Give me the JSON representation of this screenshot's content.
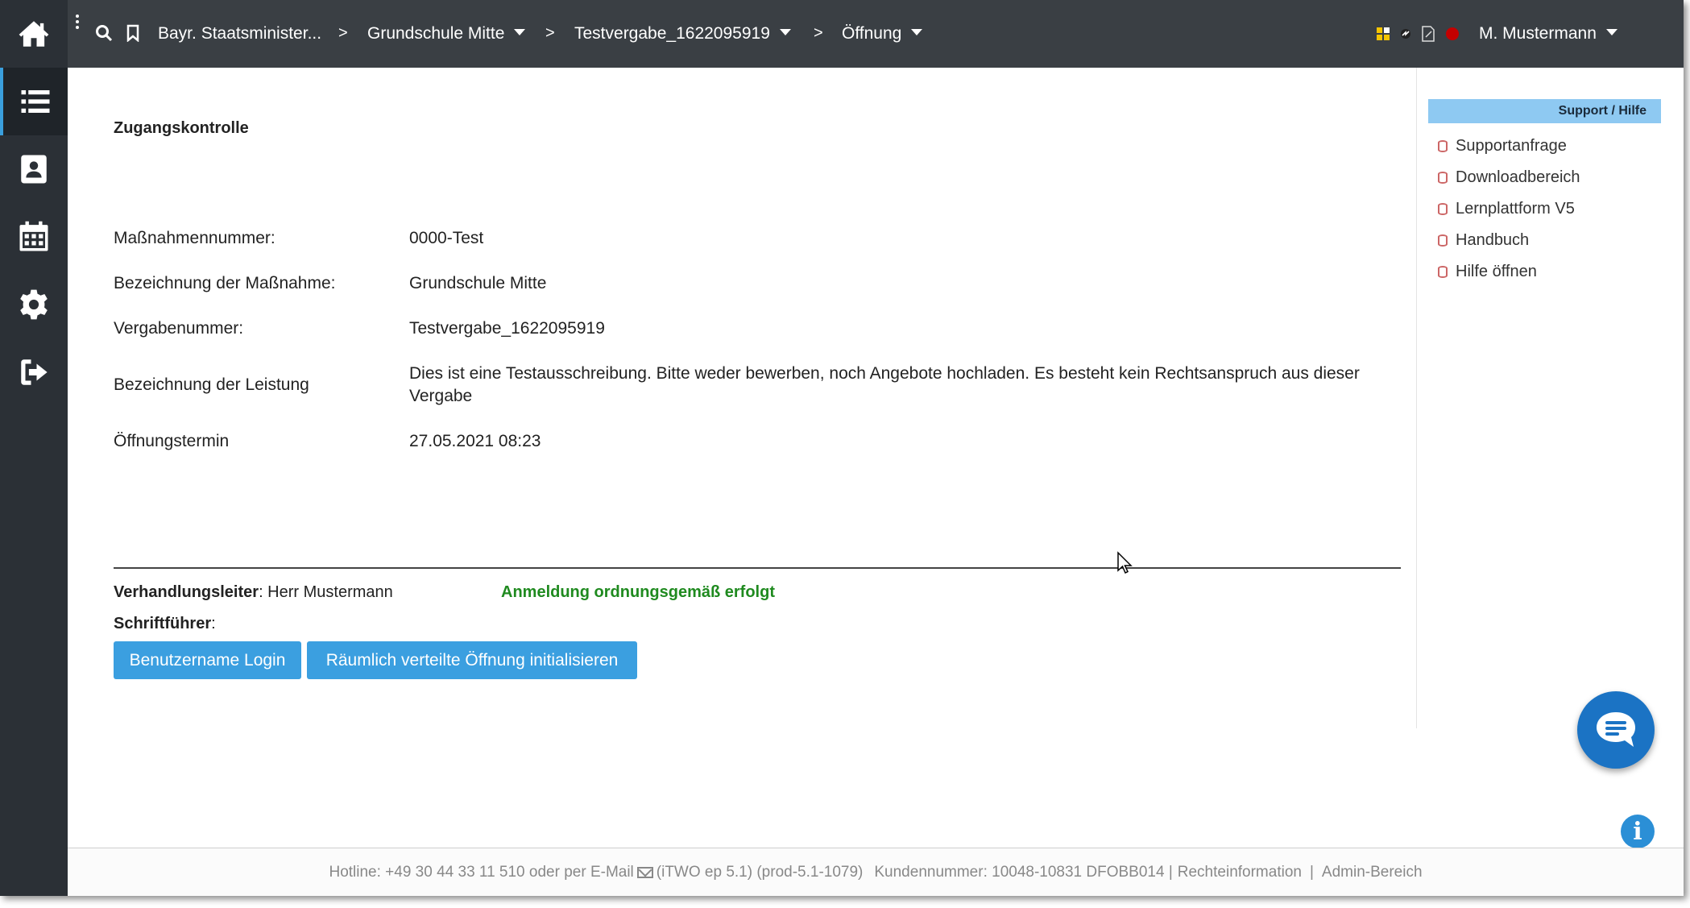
{
  "sidebar": {
    "items": [
      {
        "icon": "home-icon"
      },
      {
        "icon": "list-icon"
      },
      {
        "icon": "contact-icon"
      },
      {
        "icon": "calendar-icon"
      },
      {
        "icon": "gear-icon"
      },
      {
        "icon": "logout-icon"
      }
    ]
  },
  "topbar": {
    "crumb1": "Bayr. Staatsminister...",
    "crumb2": "Grundschule Mitte",
    "crumb3": "Testvergabe_1622095919",
    "crumb4": "Öffnung",
    "separator": ">",
    "user": "M. Mustermann"
  },
  "main": {
    "title": "Zugangskontrolle",
    "rows": [
      {
        "label": "Maßnahmennummer:",
        "value": "0000-Test"
      },
      {
        "label": "Bezeichnung der Maßnahme:",
        "value": "Grundschule Mitte"
      },
      {
        "label": "Vergabenummer:",
        "value": "Testvergabe_1622095919"
      },
      {
        "label": "Bezeichnung der Leistung",
        "value": "Dies ist eine Testausschreibung. Bitte weder bewerben, noch Angebote hochladen. Es besteht kein Rechtsanspruch aus dieser Vergabe"
      },
      {
        "label": "Öffnungstermin",
        "value": "27.05.2021 08:23"
      }
    ],
    "lead_label": "Verhandlungsleiter",
    "lead_value": ": Herr Mustermann",
    "status": "Anmeldung ordnungsgemäß erfolgt",
    "writer_label": "Schriftführer",
    "writer_colon": ":",
    "btn_login": "Benutzername Login",
    "btn_init": "Räumlich verteilte Öffnung initialisieren"
  },
  "support": {
    "heading": "Support / Hilfe",
    "items": [
      "Supportanfrage",
      "Downloadbereich",
      "Lernplattform V5",
      "Handbuch",
      "Hilfe öffnen"
    ]
  },
  "info_glyph": "i",
  "footer": {
    "hotline": "Hotline: +49 30 44 33 11 510 oder per E-Mail",
    "version": "(iTWO ep 5.1) (prod-5.1-1079)",
    "customer": "Kundennummer: 10048-10831 DFOBB014 |",
    "rights": "Rechteinformation",
    "pipe": "|",
    "admin": "Admin-Bereich"
  },
  "colors": {
    "sidebar": "#2b3036",
    "topbar": "#3a3f44",
    "accent": "#3b9fe0",
    "status_ok": "#1f8a1f",
    "chat": "#1b73c4"
  }
}
